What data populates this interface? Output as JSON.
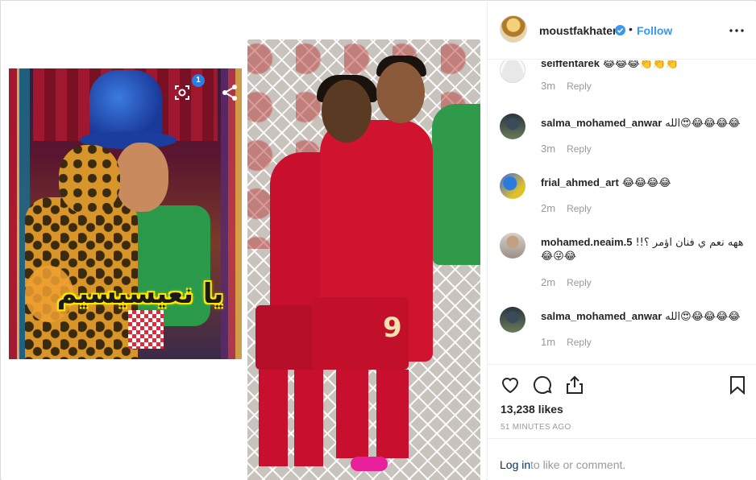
{
  "media": {
    "caption_arabic": "يا نعيسيسيم",
    "carousel_count": "1"
  },
  "header": {
    "username": "moustfakhater",
    "separator": "•",
    "follow_label": "Follow"
  },
  "comments": [
    {
      "user": "seiffentarek",
      "text": "😂😂😂👏👏👏",
      "time": "3m",
      "reply": "Reply"
    },
    {
      "user": "salma_mohamed_anwar",
      "text": "الله😍😂😂😂😂",
      "time": "3m",
      "reply": "Reply"
    },
    {
      "user": "frial_ahmed_art",
      "text": "😂😂😂😂",
      "time": "2m",
      "reply": "Reply"
    },
    {
      "user": "mohamed.neaim.5",
      "text": "!!ههه نعم ي فنان اؤمر ؟",
      "text_line2": "😂😜😂",
      "time": "2m",
      "reply": "Reply"
    },
    {
      "user": "salma_mohamed_anwar",
      "text": "الله😍😂😂😂😂",
      "time": "1m",
      "reply": "Reply"
    }
  ],
  "actions": {
    "likes": "13,238 likes",
    "posted_ago": "51 MINUTES AGO"
  },
  "login": {
    "link": "Log in",
    "rest": "to like or comment."
  },
  "colors": {
    "link_blue": "#3897f0",
    "text": "#262626",
    "muted": "#999999",
    "login_link": "#003569"
  }
}
